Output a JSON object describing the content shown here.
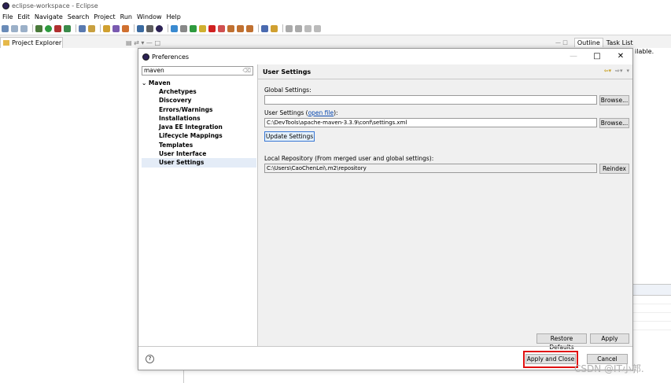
{
  "window": {
    "title": "eclipse-workspace - Eclipse"
  },
  "menubar": {
    "items": [
      "File",
      "Edit",
      "Navigate",
      "Search",
      "Project",
      "Run",
      "Window",
      "Help"
    ]
  },
  "project_explorer": {
    "tab_label": "Project Explorer",
    "tab_suffix": "⌘"
  },
  "outline": {
    "tab_label": "Outline",
    "task_list_label": "Task List",
    "panel_text": "ilable."
  },
  "dialog": {
    "title": "Preferences",
    "filter_value": "maven",
    "tree": {
      "root": "Maven",
      "children": [
        "Archetypes",
        "Discovery",
        "Errors/Warnings",
        "Installations",
        "Java EE Integration",
        "Lifecycle Mappings",
        "Templates",
        "User Interface",
        "User Settings"
      ]
    },
    "page_title": "User Settings",
    "global_settings_label": "Global Settings:",
    "global_settings_value": "",
    "browse_label": "Browse...",
    "user_settings_label_prefix": "User Settings (",
    "user_settings_link": "open file",
    "user_settings_label_suffix": "):",
    "user_settings_value": "C:\\DevTools\\apache-maven-3.3.9\\conf\\settings.xml",
    "update_settings_label": "Update Settings",
    "local_repo_label": "Local Repository (From merged user and global settings):",
    "local_repo_value": "C:\\Users\\CaoChenLei\\.m2\\repository",
    "reindex_label": "Reindex",
    "restore_defaults_label": "Restore Defaults",
    "apply_label": "Apply",
    "apply_close_label": "Apply and Close",
    "cancel_label": "Cancel",
    "minimize_glyph": "—",
    "maximize_glyph": "□",
    "close_glyph": "✕",
    "help_glyph": "?"
  },
  "watermark": "CSDN @IT小郭.",
  "colors": {
    "highlight": "#e01010",
    "selected_row": "#e4ecf7",
    "link": "#0645ad"
  }
}
